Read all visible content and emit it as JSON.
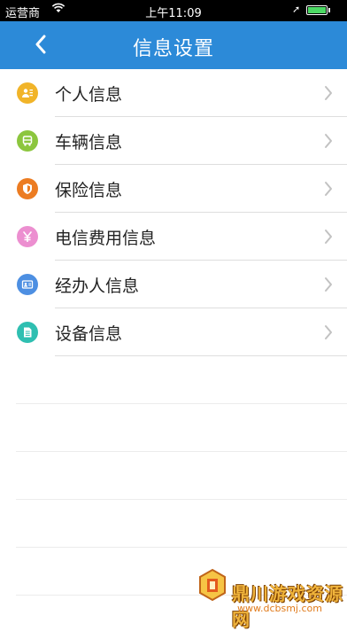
{
  "status_bar": {
    "carrier": "运营商",
    "time": "上午11:09",
    "battery_level": 1.0
  },
  "header": {
    "title": "信息设置"
  },
  "menu": {
    "items": [
      {
        "label": "个人信息",
        "icon": "person-id-icon",
        "color": "#f1b429"
      },
      {
        "label": "车辆信息",
        "icon": "vehicle-icon",
        "color": "#8cc63e"
      },
      {
        "label": "保险信息",
        "icon": "shield-icon",
        "color": "#ec7c22"
      },
      {
        "label": "电信费用信息",
        "icon": "yuan-icon",
        "color": "#ec8fd0"
      },
      {
        "label": "经办人信息",
        "icon": "id-card-icon",
        "color": "#4d8fe2"
      },
      {
        "label": "设备信息",
        "icon": "document-icon",
        "color": "#2fbfb1"
      }
    ]
  },
  "watermark": {
    "text": "鼎川游戏资源网",
    "url": "www.dcbsmj.com"
  }
}
